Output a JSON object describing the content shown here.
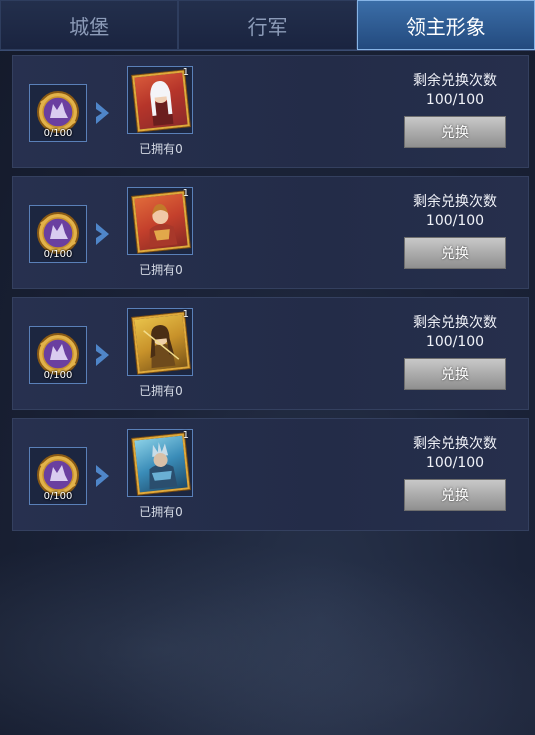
{
  "tabs": [
    {
      "label": "城堡",
      "active": false
    },
    {
      "label": "行军",
      "active": false
    },
    {
      "label": "领主形象",
      "active": true
    }
  ],
  "colors": {
    "accent": "#2f5c94",
    "card_bg": "#252e4b",
    "button_gray": "#a8a8a8",
    "frame_gold": "#e0a93a"
  },
  "items": [
    {
      "token": {
        "icon": "purple-wolf-token-icon",
        "count": "0/100"
      },
      "arrow_icon": "chevron-right-icon",
      "hero": {
        "icon": "silver-hair-hero-portrait",
        "qty": "1",
        "owned": "已拥有0"
      },
      "remaining_label": "剩余兑换次数",
      "remaining_value": "100/100",
      "exchange_label": "兑换"
    },
    {
      "token": {
        "icon": "purple-wolf-token-icon",
        "count": "0/100"
      },
      "arrow_icon": "chevron-right-icon",
      "hero": {
        "icon": "red-armor-hero-portrait",
        "qty": "1",
        "owned": "已拥有0"
      },
      "remaining_label": "剩余兑换次数",
      "remaining_value": "100/100",
      "exchange_label": "兑换"
    },
    {
      "token": {
        "icon": "purple-wolf-token-icon",
        "count": "0/100"
      },
      "arrow_icon": "chevron-right-icon",
      "hero": {
        "icon": "gold-archer-hero-portrait",
        "qty": "1",
        "owned": "已拥有0"
      },
      "remaining_label": "剩余兑换次数",
      "remaining_value": "100/100",
      "exchange_label": "兑换"
    },
    {
      "token": {
        "icon": "purple-wolf-token-icon",
        "count": "0/100"
      },
      "arrow_icon": "chevron-right-icon",
      "hero": {
        "icon": "blue-armor-hero-portrait",
        "qty": "1",
        "owned": "已拥有0"
      },
      "remaining_label": "剩余兑换次数",
      "remaining_value": "100/100",
      "exchange_label": "兑换"
    }
  ]
}
